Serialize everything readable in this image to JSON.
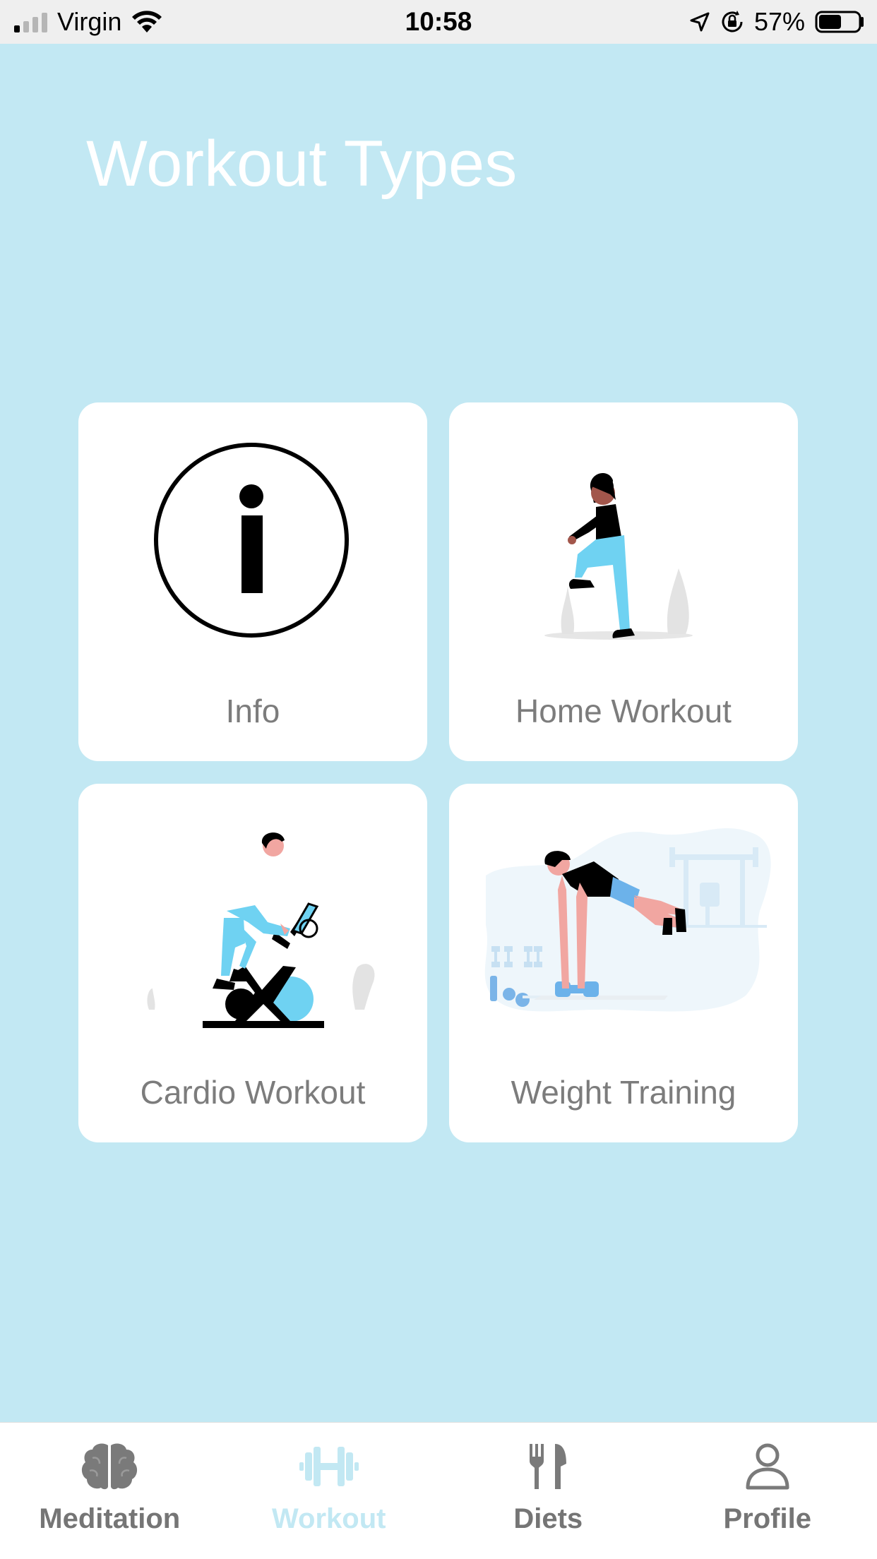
{
  "status_bar": {
    "carrier": "Virgin",
    "time": "10:58",
    "battery": "57%",
    "battery_level": 0.57
  },
  "page": {
    "title": "Workout Types"
  },
  "cards": [
    {
      "label": "Info",
      "icon": "info-circle-icon"
    },
    {
      "label": "Home Workout",
      "icon": "woman-step-up-illustration"
    },
    {
      "label": "Cardio Workout",
      "icon": "man-on-exercise-bike-illustration"
    },
    {
      "label": "Weight Training",
      "icon": "man-dumbbell-plank-illustration"
    }
  ],
  "tab_bar": {
    "tabs": [
      {
        "label": "Meditation",
        "icon": "brain-icon",
        "active": false
      },
      {
        "label": "Workout",
        "icon": "dumbbell-icon",
        "active": true
      },
      {
        "label": "Diets",
        "icon": "fork-knife-icon",
        "active": false
      },
      {
        "label": "Profile",
        "icon": "person-icon",
        "active": false
      }
    ]
  },
  "colors": {
    "background": "#c2e8f3",
    "accent": "#6fd2f2",
    "card": "#ffffff",
    "label_gray": "#7c7c7c",
    "tab_inactive": "#757575"
  }
}
